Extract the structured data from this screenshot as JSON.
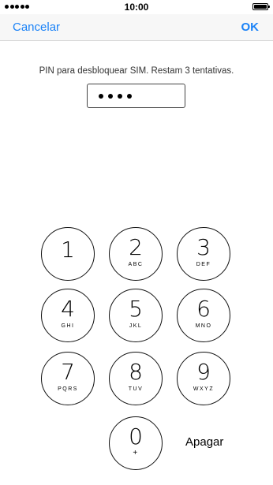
{
  "status_bar": {
    "time": "10:00"
  },
  "nav": {
    "cancel_label": "Cancelar",
    "ok_label": "OK"
  },
  "prompt": {
    "text": "PIN para desbloquear SIM. Restam 3 tentativas."
  },
  "pin_field": {
    "digits_entered": 4
  },
  "keypad": {
    "keys": [
      {
        "digit": "1",
        "letters": ""
      },
      {
        "digit": "2",
        "letters": "ABC"
      },
      {
        "digit": "3",
        "letters": "DEF"
      },
      {
        "digit": "4",
        "letters": "GHI"
      },
      {
        "digit": "5",
        "letters": "JKL"
      },
      {
        "digit": "6",
        "letters": "MNO"
      },
      {
        "digit": "7",
        "letters": "PQRS"
      },
      {
        "digit": "8",
        "letters": "TUV"
      },
      {
        "digit": "9",
        "letters": "WXYZ"
      },
      {
        "digit": "0",
        "letters": "+"
      }
    ],
    "delete_label": "Apagar"
  },
  "colors": {
    "accent": "#1a82f7",
    "nav_background": "#f7f7f7"
  }
}
